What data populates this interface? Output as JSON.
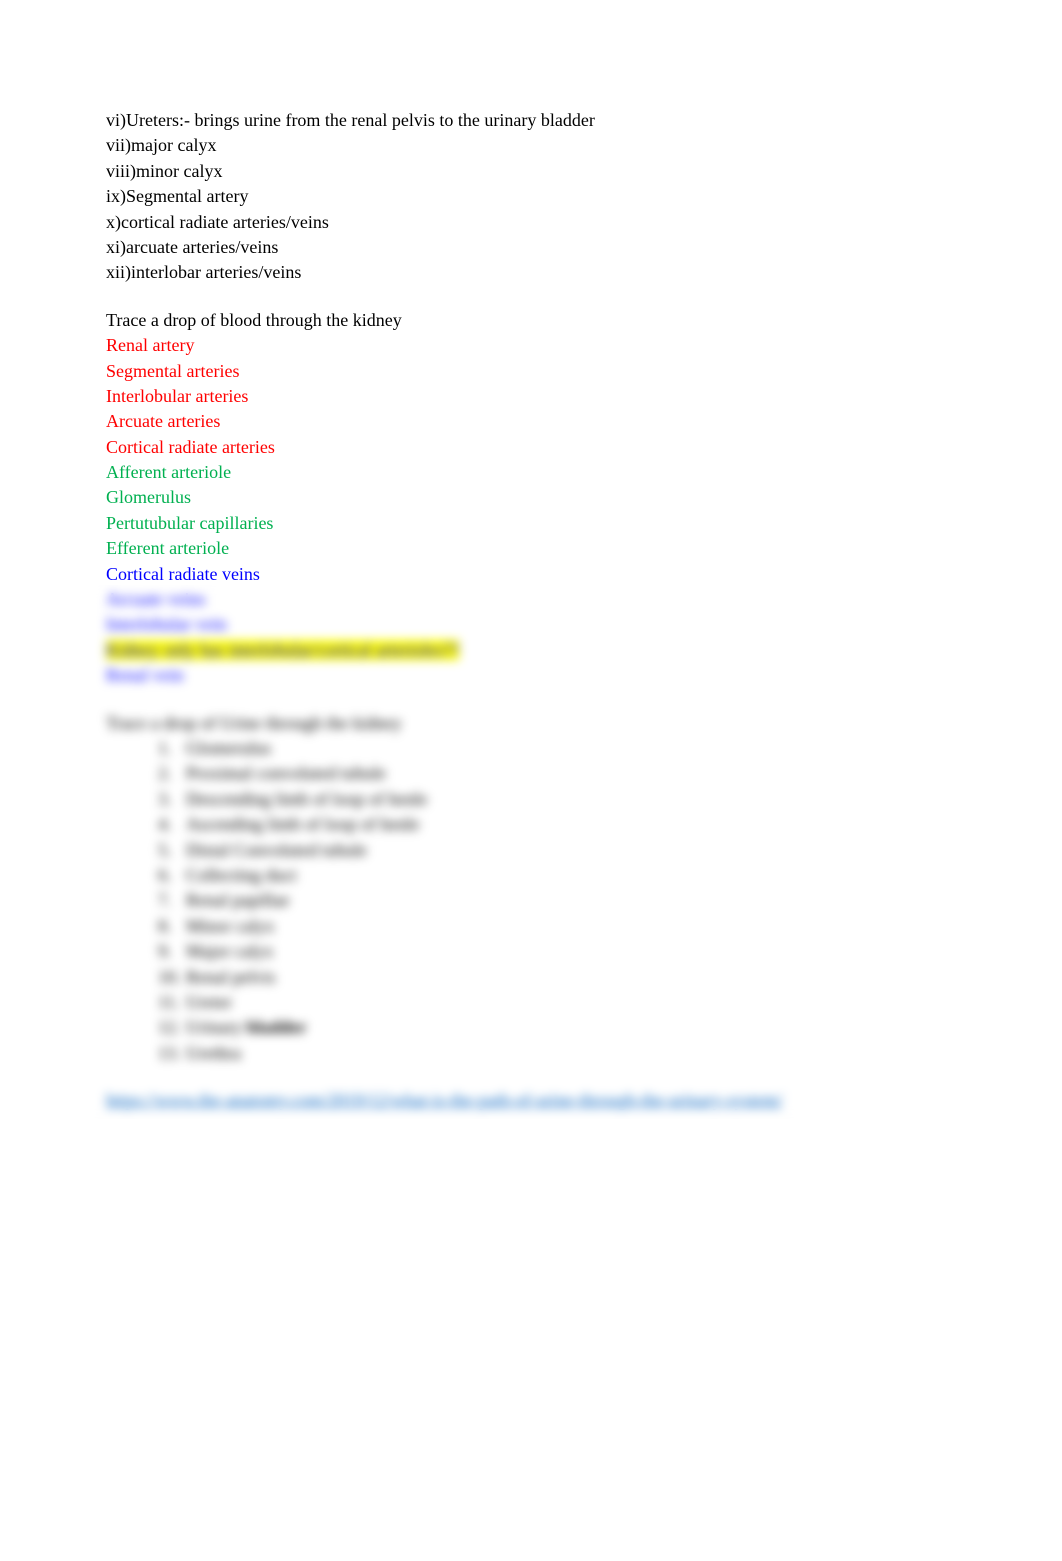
{
  "structures": [
    "vi)Ureters:- brings urine from the renal pelvis to the urinary bladder",
    "vii)major calyx",
    "viii)minor calyx",
    "ix)Segmental artery",
    "x)cortical radiate arteries/veins",
    "xi)arcuate arteries/veins",
    "xii)interlobar arteries/veins"
  ],
  "blood_heading": "Trace a drop of blood through the kidney",
  "blood_path": [
    {
      "text": "Renal artery",
      "cls": "red"
    },
    {
      "text": "Segmental arteries",
      "cls": "red"
    },
    {
      "text": "Interlobular arteries",
      "cls": "red"
    },
    {
      "text": "Arcuate arteries",
      "cls": "red"
    },
    {
      "text": "Cortical radiate arteries",
      "cls": "red"
    },
    {
      "text": "Afferent arteriole",
      "cls": "green"
    },
    {
      "text": "Glomerulus",
      "cls": "green"
    },
    {
      "text": "Pertutubular capillaries",
      "cls": "green"
    },
    {
      "text": "Efferent arteriole",
      "cls": "green"
    },
    {
      "text": "Cortical radiate veins",
      "cls": "blue"
    },
    {
      "text": "Arcuate veins",
      "cls": "blue"
    },
    {
      "text": "Interlobular vein",
      "cls": "blue"
    },
    {
      "text": "Kidney only has interlobular/cortical arterioles??",
      "cls": "blue",
      "hl": true
    },
    {
      "text": "Renal vein",
      "cls": "blue"
    }
  ],
  "urine_heading": "Trace a drop of Urine through the kidney",
  "urine_path": [
    "Glomerulus",
    "Proximal convoluted tubule",
    "Descending limb of loop of henle",
    "Ascending limb of loop of henle",
    "Distal Convoluted tubule",
    "Collecting duct",
    "Renal papillae",
    "Minor calyx",
    "Major calyx",
    "Renal pelvis",
    "Ureter",
    "Urinary bladder",
    "Urethra"
  ],
  "urine_bold_index": 11,
  "urine_bold_part": "bladder",
  "urine_plain_part": "Urinary ",
  "link_text": "https://www.the-anatomy.com/2019/12/what-is-the-path-of-urine-through-the-urinary-system/"
}
